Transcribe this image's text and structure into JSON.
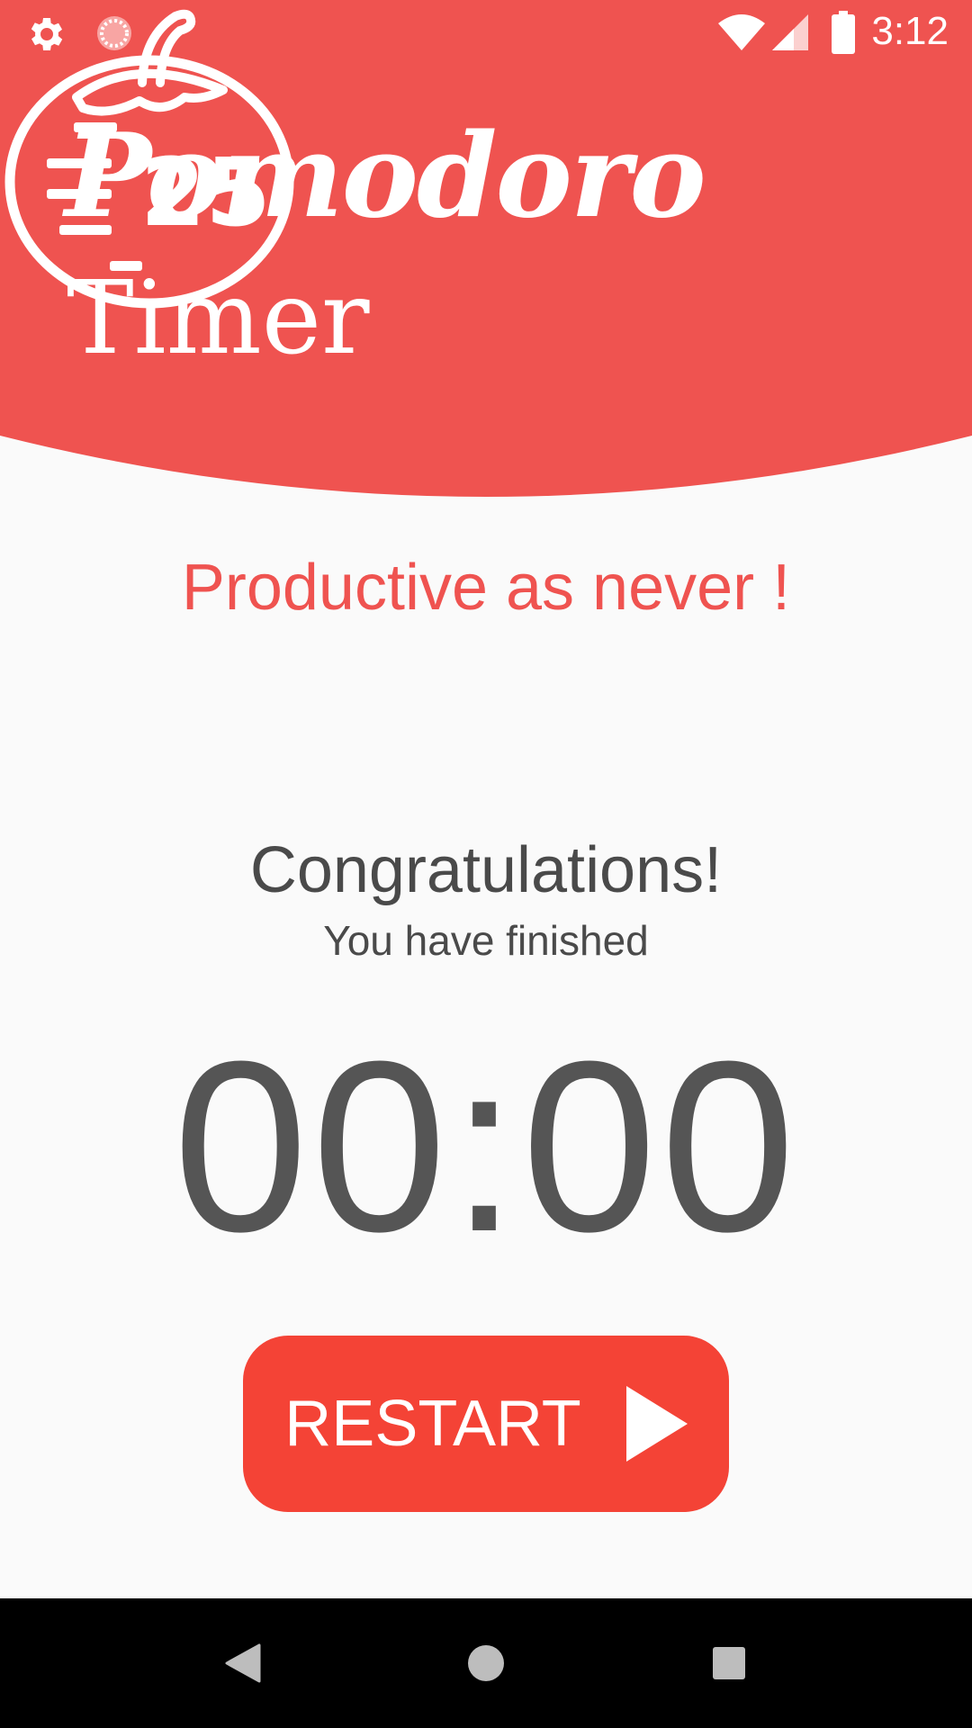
{
  "status_bar": {
    "time": "3:12",
    "icons": [
      "gear-icon",
      "loading-icon",
      "wifi-icon",
      "signal-icon",
      "battery-icon"
    ]
  },
  "header": {
    "title_script": "Pomodoro",
    "title_plain": "Timer",
    "logo_number": "25",
    "background_color": "#ef5350"
  },
  "main": {
    "tagline": "Productive as never !",
    "congrats_heading": "Congratulations!",
    "congrats_sub": "You have finished",
    "timer_value": "00:00"
  },
  "restart_button": {
    "label": "RESTART",
    "color": "#f44336"
  },
  "nav_bar": {
    "buttons": [
      "back-icon",
      "home-icon",
      "recents-icon"
    ]
  }
}
